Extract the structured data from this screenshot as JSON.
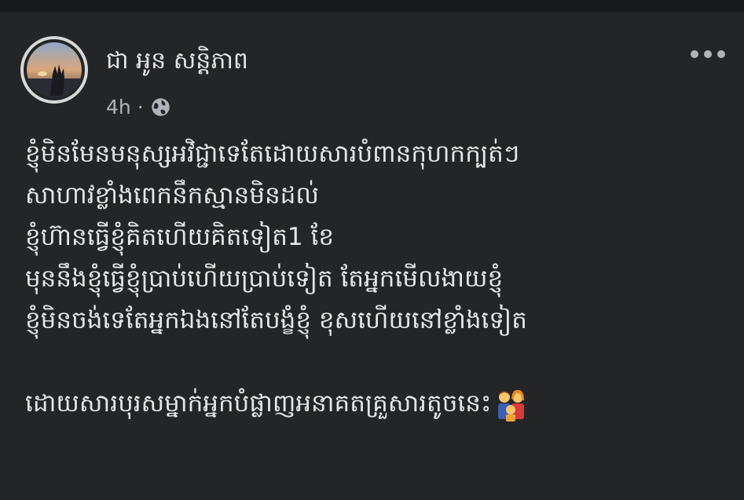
{
  "post": {
    "author_name": "ជា អូន សន្តិភាព",
    "timestamp": "4h",
    "separator": "·",
    "audience_icon": "globe-icon",
    "more_icon": "more-options-icon",
    "lines": [
      "ខ្ញុំមិនមែនមនុស្សអវិជ្ជាទេតែដោយសារបំពានកុហកក្បត់ៗ",
      "សាហាវខ្លាំងពេកនឹកស្មានមិនដល់",
      "ខ្ញុំហ៊ានធ្វើខ្ញុំគិតហើយគិតទៀត1 ខែ",
      "មុននឹងខ្ញុំធ្វើខ្ញុំប្រាប់ហើយប្រាប់ទៀត តែអ្នកមើលងាយខ្ញុំ",
      "ខ្ញុំមិនចង់ទេតែអ្នកឯងនៅតែបង្ខំខ្ញុំ ខុសហើយនៅខ្លាំងទៀត",
      "",
      "ដោយសារបុរសម្នាក់អ្នកបំផ្លាញអនាគតគ្រួសារតូចនេះ"
    ],
    "trailing_emoji": "family-emoji"
  },
  "colors": {
    "background": "#242526",
    "primary_text": "#e4e6eb",
    "secondary_text": "#b0b3b8"
  }
}
